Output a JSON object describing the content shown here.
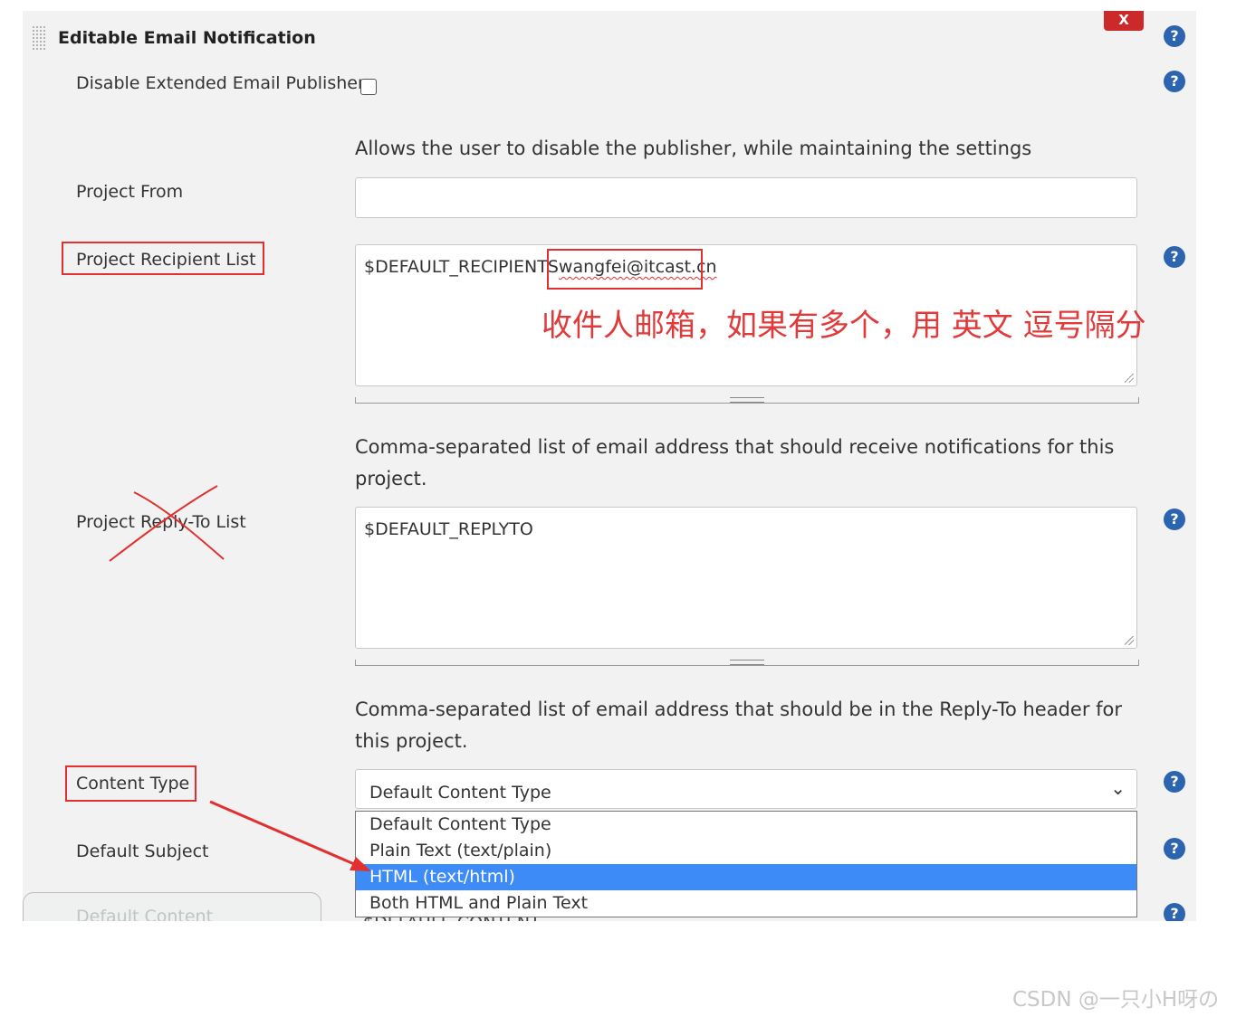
{
  "section": {
    "title": "Editable Email Notification",
    "close_label": "X"
  },
  "disable_publisher": {
    "label": "Disable Extended Email Publisher",
    "checked": false,
    "description": "Allows the user to disable the publisher, while maintaining the settings"
  },
  "project_from": {
    "label": "Project From",
    "value": ""
  },
  "recipient_list": {
    "label": "Project Recipient List",
    "value_prefix": "$DEFAULT_RECIPIENTS",
    "value_email": "wangfei@itcast.cn",
    "description": "Comma-separated list of email address that should receive notifications for this project."
  },
  "reply_to": {
    "label": "Project Reply-To List",
    "value": "$DEFAULT_REPLYTO",
    "description": "Comma-separated list of email address that should be in the Reply-To header for this project."
  },
  "content_type": {
    "label": "Content Type",
    "selected": "Default Content Type",
    "options": [
      "Default Content Type",
      "Plain Text (text/plain)",
      "HTML (text/html)",
      "Both HTML and Plain Text"
    ],
    "highlighted_option": "HTML (text/html)",
    "partial_value_below": "$DEFAULT_CONTENT"
  },
  "default_subject": {
    "label": "Default Subject"
  },
  "default_content": {
    "label": "Default Content"
  },
  "help_icon_glyph": "?",
  "annotation": {
    "note": "收件人邮箱，如果有多个，用 英文 逗号隔分",
    "color": "#e03a3a"
  },
  "watermark": "CSDN @一只小H呀の",
  "colors": {
    "help_icon": "#2c64b0",
    "close_button": "#cc2a2a",
    "selected_option": "#3d8bf7",
    "panel_background": "#f2f2f2"
  }
}
